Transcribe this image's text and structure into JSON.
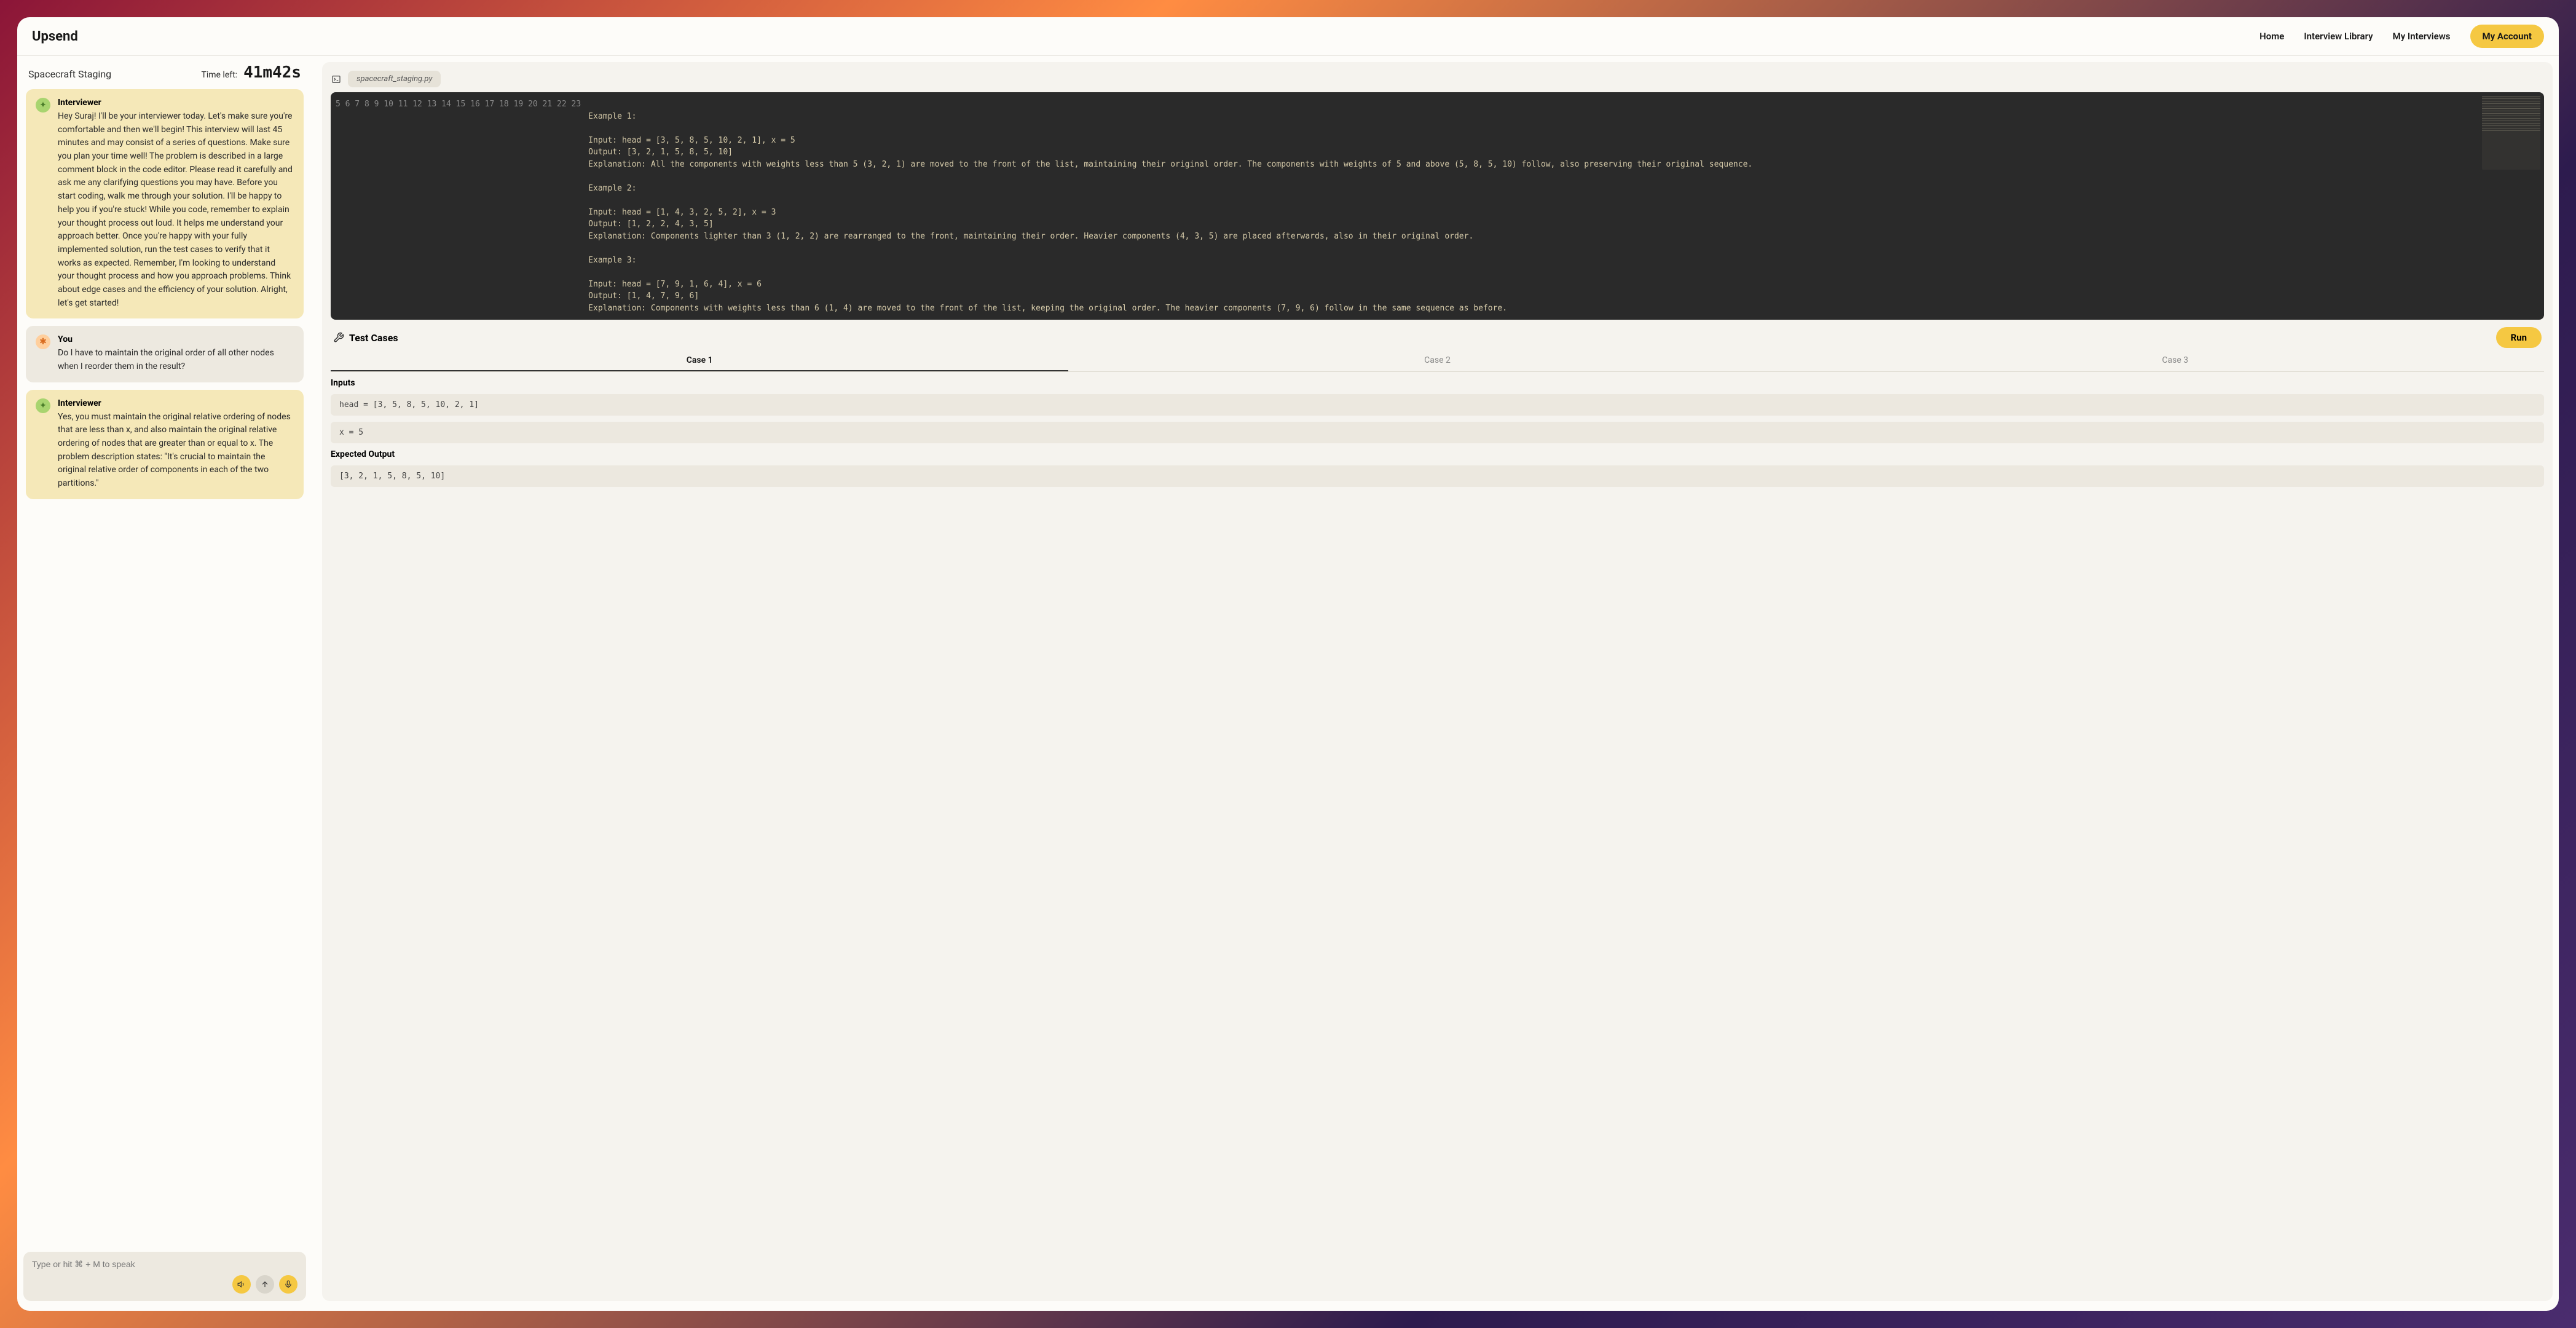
{
  "brand": "Upsend",
  "nav": {
    "home": "Home",
    "library": "Interview Library",
    "interviews": "My Interviews",
    "account": "My Account"
  },
  "problem_title": "Spacecraft Staging",
  "timer": {
    "label": "Time left:",
    "value": "41m42s"
  },
  "chat": {
    "messages": [
      {
        "role": "interviewer",
        "sender": "Interviewer",
        "text": "Hey Suraj! I'll be your interviewer today. Let's make sure you're comfortable and then we'll begin! This interview will last 45 minutes and may consist of a series of questions. Make sure you plan your time well! The problem is described in a large comment block in the code editor. Please read it carefully and ask me any clarifying questions you may have. Before you start coding, walk me through your solution. I'll be happy to help you if you're stuck! While you code, remember to explain your thought process out loud. It helps me understand your approach better. Once you're happy with your fully implemented solution, run the test cases to verify that it works as expected. Remember, I'm looking to understand your thought process and how you approach problems. Think about edge cases and the efficiency of your solution. Alright, let's get started!"
      },
      {
        "role": "you",
        "sender": "You",
        "text": "Do I have to maintain the original order of all other nodes when I reorder them in the result?"
      },
      {
        "role": "interviewer",
        "sender": "Interviewer",
        "text": "Yes, you must maintain the original relative ordering of nodes that are less than x, and also maintain the original relative ordering of nodes that are greater than or equal to x. The problem description states: \"It's crucial to maintain the original relative order of components in each of the two partitions.\""
      }
    ],
    "input_placeholder": "Type or hit ⌘ + M to speak"
  },
  "editor": {
    "file_name": "spacecraft_staging.py",
    "gutter_start": 5,
    "gutter_end": 23,
    "lines": [
      "",
      "Example 1:",
      "",
      "Input: head = [3, 5, 8, 5, 10, 2, 1], x = 5",
      "Output: [3, 2, 1, 5, 8, 5, 10]",
      "Explanation: All the components with weights less than 5 (3, 2, 1) are moved to the front of the list, maintaining their original order. The components with weights of 5 and above (5, 8, 5, 10) follow, also preserving their original sequence.",
      "",
      "Example 2:",
      "",
      "Input: head = [1, 4, 3, 2, 5, 2], x = 3",
      "Output: [1, 2, 2, 4, 3, 5]",
      "Explanation: Components lighter than 3 (1, 2, 2) are rearranged to the front, maintaining their order. Heavier components (4, 3, 5) are placed afterwards, also in their original order.",
      "",
      "Example 3:",
      "",
      "Input: head = [7, 9, 1, 6, 4], x = 6",
      "Output: [1, 4, 7, 9, 6]",
      "Explanation: Components with weights less than 6 (1, 4) are moved to the front of the list, keeping the original order. The heavier components (7, 9, 6) follow in the same sequence as before.",
      ""
    ]
  },
  "tests": {
    "title": "Test Cases",
    "run_label": "Run",
    "tabs": [
      "Case 1",
      "Case 2",
      "Case 3"
    ],
    "active_tab": 0,
    "inputs_label": "Inputs",
    "expected_label": "Expected Output",
    "cases": [
      {
        "inputs": [
          "head = [3, 5, 8, 5, 10, 2, 1]",
          "x = 5"
        ],
        "expected": "[3, 2, 1, 5, 8, 5, 10]"
      }
    ]
  }
}
